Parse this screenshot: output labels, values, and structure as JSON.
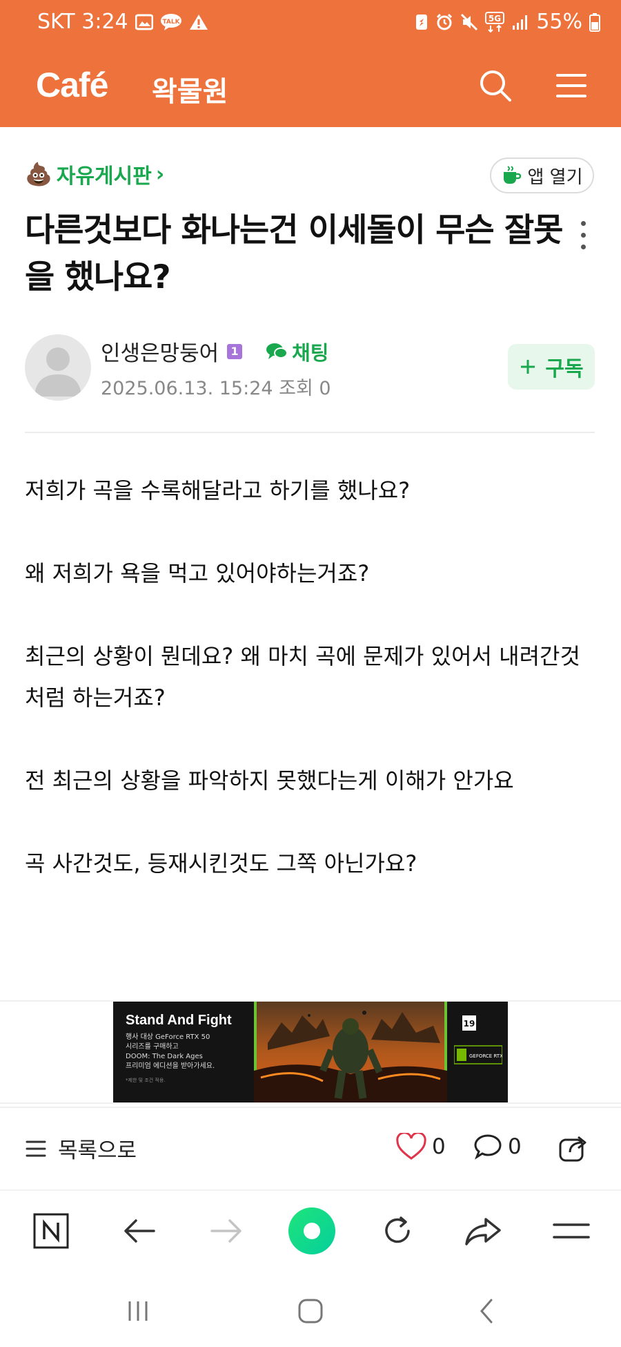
{
  "status_bar": {
    "carrier_time": "SKT 3:24",
    "talk_badge": "TALK",
    "network": "5G",
    "battery": "55%"
  },
  "header": {
    "brand": "Café",
    "cafe_name": "왁물원",
    "accent_color": "#ee723b"
  },
  "board": {
    "emoji": "💩",
    "name": "자유게시판",
    "chevron": "›",
    "open_app_label": "앱 열기"
  },
  "post": {
    "title": "다른것보다 화나는건 이세돌이 무슨 잘못을 했나요?",
    "author": "인생은망둥어",
    "level": "1",
    "chat_label": "채팅",
    "date": "2025.06.13. 15:24",
    "views_label": "조회 0",
    "subscribe_label": "구독",
    "paragraphs": [
      "저희가 곡을 수록해달라고 하기를 했나요?",
      "왜 저희가 욕을 먹고 있어야하는거죠?",
      "최근의 상황이 뭔데요? 왜 마치 곡에 문제가 있어서 내려간것처럼 하는거죠?",
      "전 최근의 상황을 파악하지 못했다는게 이해가 안가요",
      "곡 사간것도, 등재시킨것도 그쪽 아닌가요?"
    ]
  },
  "ad": {
    "title": "Stand And Fight",
    "subtitle": "행사 대상 GeForce RTX 50\n시리즈를 구매하고\nDOOM: The Dark Ages\n프리미엄 에디션을 받아가세요.",
    "note": "*제한 및 조건 적용.",
    "rating": "19",
    "nvidia_label": "GEFORCE RTX"
  },
  "actions": {
    "list_label": "목록으로",
    "like_count": "0",
    "comment_count": "0"
  },
  "icons": {
    "search": "search-icon",
    "menu": "hamburger-icon",
    "more": "more-vertical-icon",
    "share": "share-icon"
  }
}
